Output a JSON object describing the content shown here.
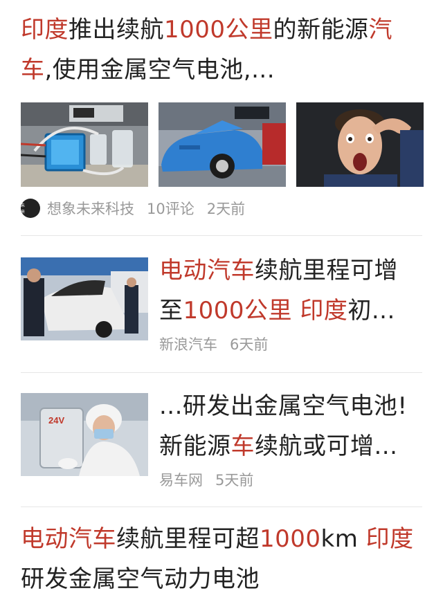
{
  "articles": [
    {
      "title_parts": [
        {
          "text": "印度",
          "hl": true
        },
        {
          "text": "推出续航",
          "hl": false
        },
        {
          "text": "1000公里",
          "hl": true
        },
        {
          "text": "的新能源",
          "hl": false
        },
        {
          "text": "汽",
          "hl": true
        }
      ],
      "title_line2": [
        {
          "text": "车",
          "hl": true
        },
        {
          "text": ",使用金属空气电池,...",
          "hl": false
        }
      ],
      "source": "想象未来科技",
      "avatar_text": "想象未来科技",
      "comments": "10评论",
      "time": "2天前"
    },
    {
      "line1": [
        {
          "text": "电动汽车",
          "hl": true
        },
        {
          "text": "续航里程可增",
          "hl": false
        }
      ],
      "line2": [
        {
          "text": "至",
          "hl": false
        },
        {
          "text": "1000公里",
          "hl": true
        },
        {
          "text": " ",
          "hl": false
        },
        {
          "text": "印度",
          "hl": true
        },
        {
          "text": "初...",
          "hl": false
        }
      ],
      "source": "新浪汽车",
      "time": "6天前"
    },
    {
      "line1": [
        {
          "text": "...研发出金属空气电池!",
          "hl": false
        }
      ],
      "line2": [
        {
          "text": "新能源",
          "hl": false
        },
        {
          "text": "车",
          "hl": true
        },
        {
          "text": "续航或可增...",
          "hl": false
        }
      ],
      "source": "易车网",
      "time": "5天前"
    },
    {
      "line1": [
        {
          "text": "电动汽车",
          "hl": true
        },
        {
          "text": "续航里程可超",
          "hl": false
        },
        {
          "text": "1000",
          "hl": true
        },
        {
          "text": "km ",
          "hl": false
        },
        {
          "text": "印度",
          "hl": true
        }
      ],
      "line2": [
        {
          "text": "研发金属空气动力电池",
          "hl": false
        }
      ]
    }
  ],
  "colors": {
    "highlight": "#c0392b",
    "meta": "#999999",
    "text": "#222222"
  },
  "battery_label": "24V"
}
